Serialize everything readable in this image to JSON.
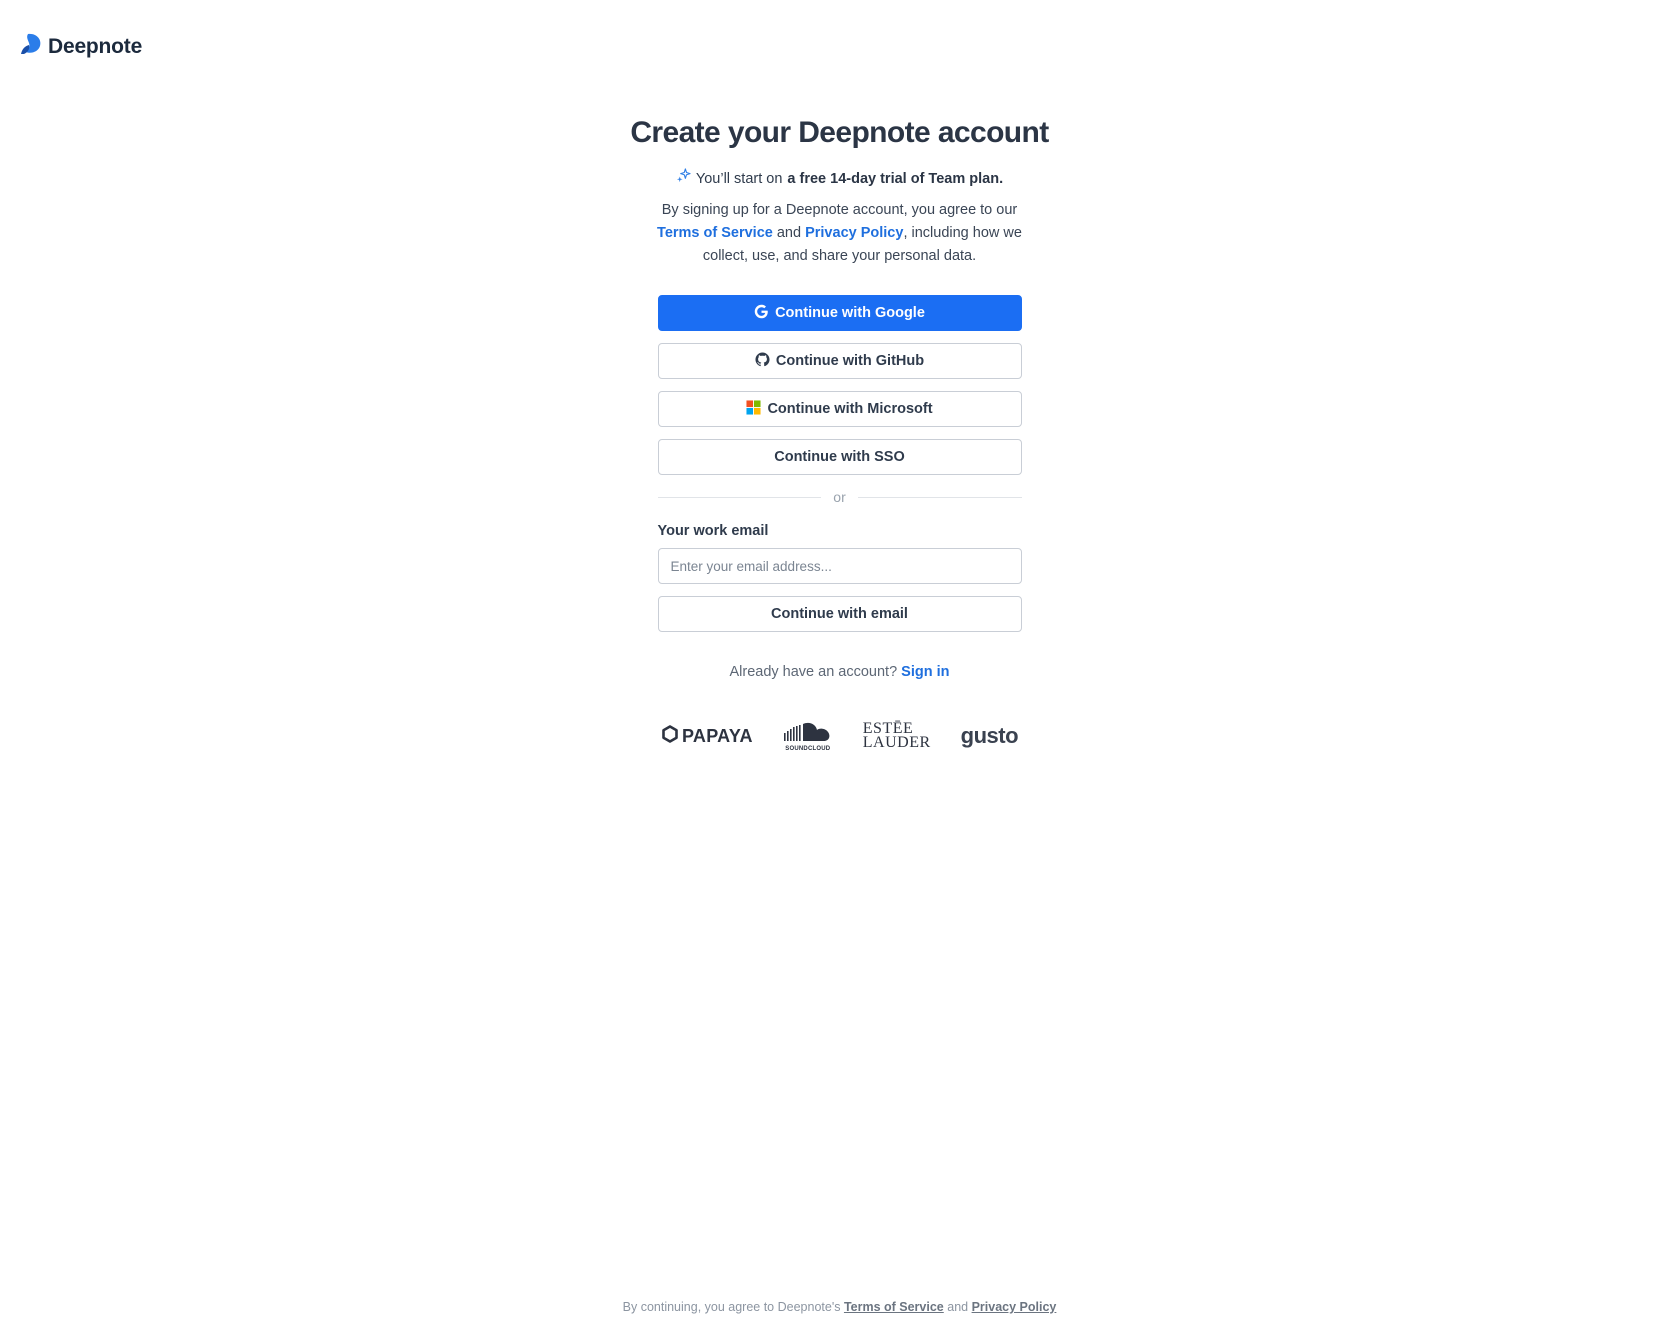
{
  "header": {
    "brand": "Deepnote"
  },
  "main": {
    "title": "Create your Deepnote account",
    "trial_prefix": "You’ll start on ",
    "trial_bold": "a free 14-day trial of Team plan.",
    "legal_prefix": "By signing up for a Deepnote account, you agree to our ",
    "terms_label": "Terms of Service",
    "legal_and": " and ",
    "privacy_label": "Privacy Policy",
    "legal_suffix": ", including how we collect, use, and share your personal data."
  },
  "auth": {
    "google_label": "Continue with Google",
    "github_label": "Continue with GitHub",
    "microsoft_label": "Continue with Microsoft",
    "sso_label": "Continue with SSO",
    "divider_text": "or",
    "email_label": "Your work email",
    "email_placeholder": "Enter your email address...",
    "email_value": "",
    "email_button_label": "Continue with email"
  },
  "signin": {
    "prompt": "Already have an account? ",
    "link": "Sign in"
  },
  "brands": {
    "papaya": "PAPAYA",
    "soundcloud": "SOUNDCLOUD",
    "estee_line1": "ESTĒE",
    "estee_line2": "LAUDER",
    "gusto": "gusto"
  },
  "footer": {
    "prefix": "By continuing, you agree to Deepnote's ",
    "terms": "Terms of Service",
    "and": " and ",
    "privacy": "Privacy Policy"
  },
  "colors": {
    "primary": "#1b6ef3",
    "link": "#1f6fde",
    "text": "#2f3b4c",
    "border": "#c9ced6"
  },
  "icons": {
    "logo": "deepnote-logo-icon",
    "sparkle": "sparkle-icon",
    "google": "google-icon",
    "github": "github-icon",
    "microsoft": "microsoft-icon"
  }
}
